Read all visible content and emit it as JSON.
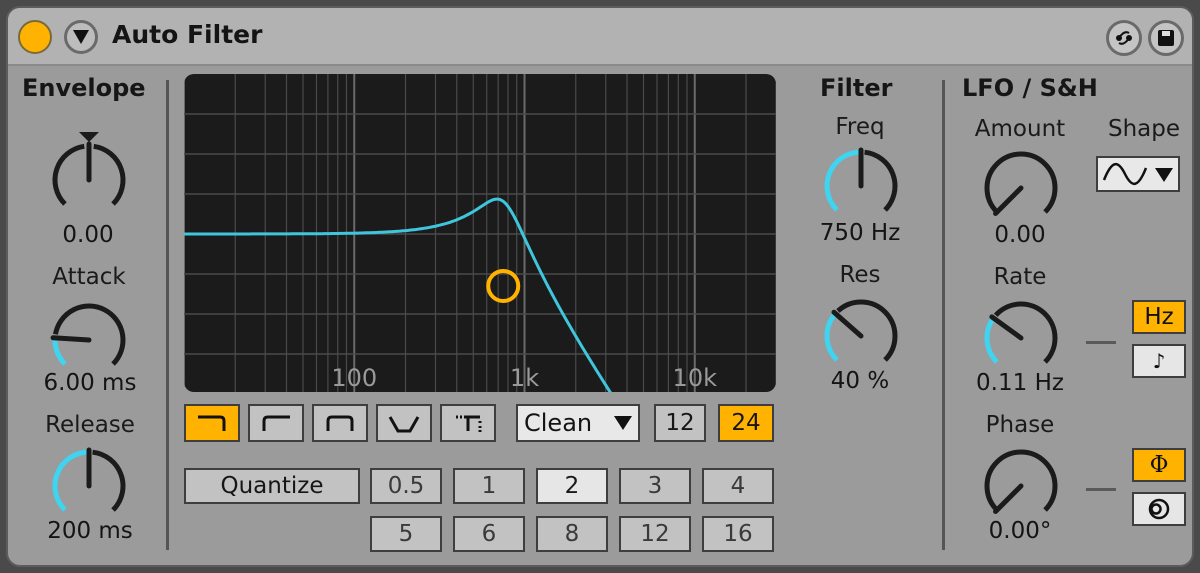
{
  "device": {
    "title": "Auto Filter",
    "power_on": true,
    "accent_color": "#ffb300",
    "knob_arc_color": "#3fd4f0"
  },
  "header_buttons": [
    {
      "name": "hot-swap-icon"
    },
    {
      "name": "save-preset-icon"
    }
  ],
  "envelope": {
    "title": "Envelope",
    "amount": {
      "value": "0.00",
      "fraction": 0.5
    },
    "attack": {
      "label": "Attack",
      "value": "6.00 ms",
      "fraction": 0.18
    },
    "release": {
      "label": "Release",
      "value": "200 ms",
      "fraction": 0.5
    }
  },
  "graph": {
    "freq_labels": [
      "100",
      "1k",
      "10k"
    ],
    "filter_type_buttons": [
      {
        "name": "lowpass",
        "active": true
      },
      {
        "name": "highpass",
        "active": false
      },
      {
        "name": "bandpass",
        "active": false
      },
      {
        "name": "notch",
        "active": false
      },
      {
        "name": "morph",
        "active": false
      }
    ],
    "circuit": {
      "selected": "Clean"
    },
    "slope_buttons": [
      {
        "label": "12",
        "active": false
      },
      {
        "label": "24",
        "active": true
      }
    ]
  },
  "quantize": {
    "label": "Quantize",
    "row1": [
      {
        "label": "0.5",
        "selected": false
      },
      {
        "label": "1",
        "selected": false
      },
      {
        "label": "2",
        "selected": true
      },
      {
        "label": "3",
        "selected": false
      },
      {
        "label": "4",
        "selected": false
      }
    ],
    "row2": [
      {
        "label": "5",
        "selected": false
      },
      {
        "label": "6",
        "selected": false
      },
      {
        "label": "8",
        "selected": false
      },
      {
        "label": "12",
        "selected": false
      },
      {
        "label": "16",
        "selected": false
      }
    ]
  },
  "filter": {
    "title": "Filter",
    "freq": {
      "label": "Freq",
      "value": "750 Hz",
      "fraction": 0.5
    },
    "res": {
      "label": "Res",
      "value": "40 %",
      "fraction": 0.32
    }
  },
  "lfo": {
    "title": "LFO / S&H",
    "amount": {
      "label": "Amount",
      "value": "0.00",
      "fraction": 0.0
    },
    "shape": {
      "label": "Shape",
      "selected": "sine"
    },
    "rate": {
      "label": "Rate",
      "value": "0.11 Hz",
      "fraction": 0.3
    },
    "rate_mode_buttons": [
      {
        "label": "Hz",
        "active": true
      },
      {
        "label": "♪",
        "active": false
      }
    ],
    "phase": {
      "label": "Phase",
      "value": "0.00°",
      "fraction": 0.0
    },
    "phase_mode_buttons": [
      {
        "label": "Φ",
        "active": true
      },
      {
        "label": "spin",
        "active": false
      }
    ]
  }
}
